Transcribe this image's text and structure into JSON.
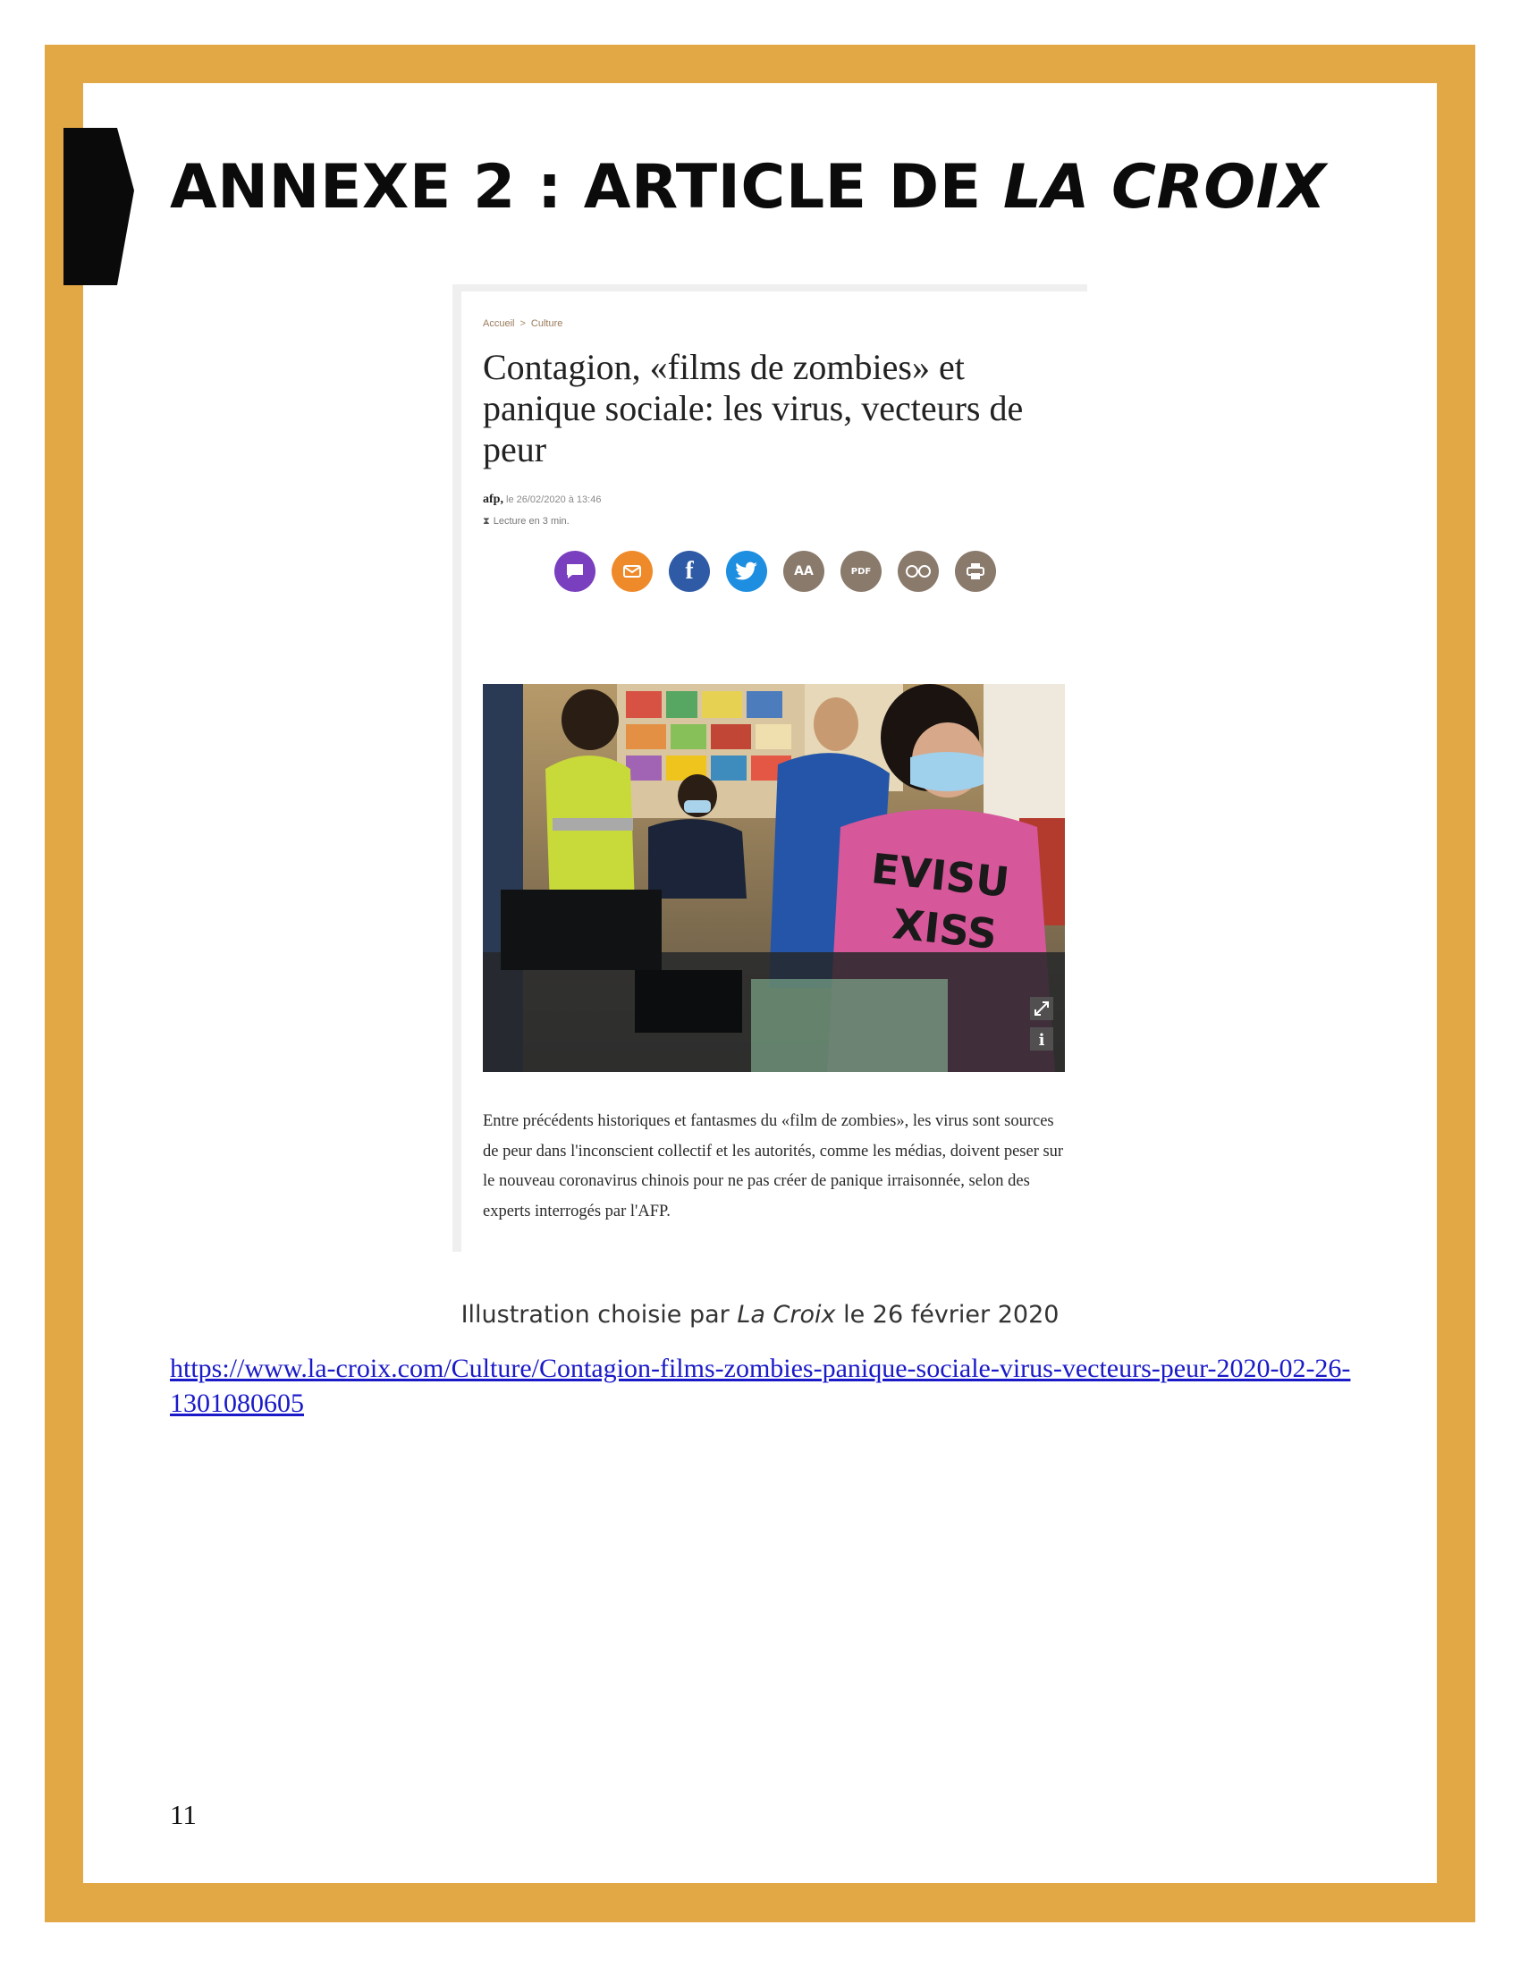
{
  "heading": {
    "prefix": "ANNEXE 2 : ARTICLE DE ",
    "italic": "LA CROIX"
  },
  "article": {
    "breadcrumb": [
      "Accueil",
      ">",
      "Culture"
    ],
    "title": "Contagion, «films de zombies» et panique sociale: les virus, vecteurs de peur",
    "source": "afp,",
    "date": "le 26/02/2020 à 13:46",
    "reading_time": "Lecture en 3 min.",
    "share_icons": [
      {
        "name": "comment-icon",
        "color": "#7a3fbf"
      },
      {
        "name": "email-icon",
        "color": "#ef8a2a"
      },
      {
        "name": "facebook-icon",
        "color": "#2f5aa6"
      },
      {
        "name": "twitter-icon",
        "color": "#1d8ee0"
      },
      {
        "name": "text-size-icon",
        "color": "#8a7a6c",
        "label": "AA"
      },
      {
        "name": "pdf-icon",
        "color": "#8a7a6c",
        "label": "PDF"
      },
      {
        "name": "reading-glasses-icon",
        "color": "#8a7a6c"
      },
      {
        "name": "print-icon",
        "color": "#8a7a6c"
      }
    ],
    "photo_overlay_text": "EVISU XISS",
    "lead": "Entre précédents historiques et fantasmes du «film de zombies», les virus sont sources de peur dans l'inconscient collectif et les autorités, comme les médias, doivent peser sur le nouveau coronavirus chinois pour ne pas créer de panique irraisonnée, selon des experts interrogés par l'AFP."
  },
  "caption": {
    "before": "Illustration choisie par ",
    "italic": "La Croix",
    "after": " le 26 février 2020"
  },
  "link": "https://www.la-croix.com/Culture/Contagion-films-zombies-panique-sociale-virus-vecteurs-peur-2020-02-26-1301080605",
  "page_number": "11",
  "colors": {
    "frame": "#e2a846",
    "link": "#1a1ac8"
  }
}
